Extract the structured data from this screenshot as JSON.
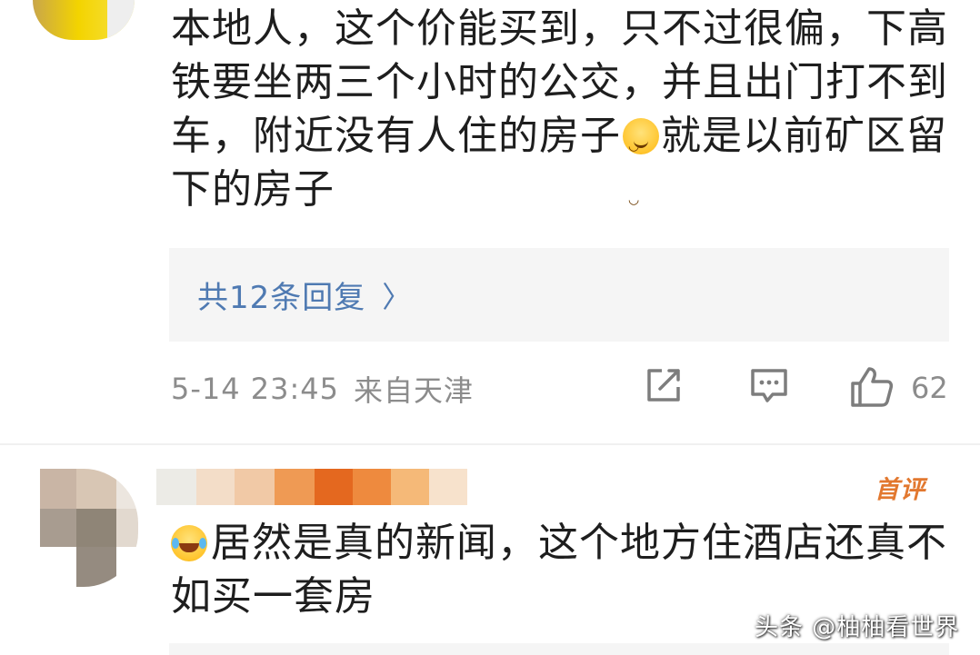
{
  "comment_1": {
    "text_before_emoji": "本地人，这个价能买到，只不过很偏，下高铁要坐两三个小时的公交，并且出门打不到车，附近没有人住的房子",
    "emoji_1": "smile-emoji",
    "text_after_emoji": "就是以前矿区留下的房子",
    "replies_label": "共12条回复",
    "timestamp": "5-14 23:45",
    "location": "来自天津",
    "like_count": "62"
  },
  "comment_2": {
    "badge": "首评",
    "emoji": "laugh-cry-emoji",
    "text": "居然是真的新闻，这个地方住酒店还真不如买一套房"
  },
  "watermark": "头条 @柚柚看世界",
  "colors": {
    "link_blue": "#4f7ab2",
    "meta_gray": "#8c8c8c",
    "badge_orange": "#e2782f",
    "reply_bg": "#f5f5f5"
  }
}
